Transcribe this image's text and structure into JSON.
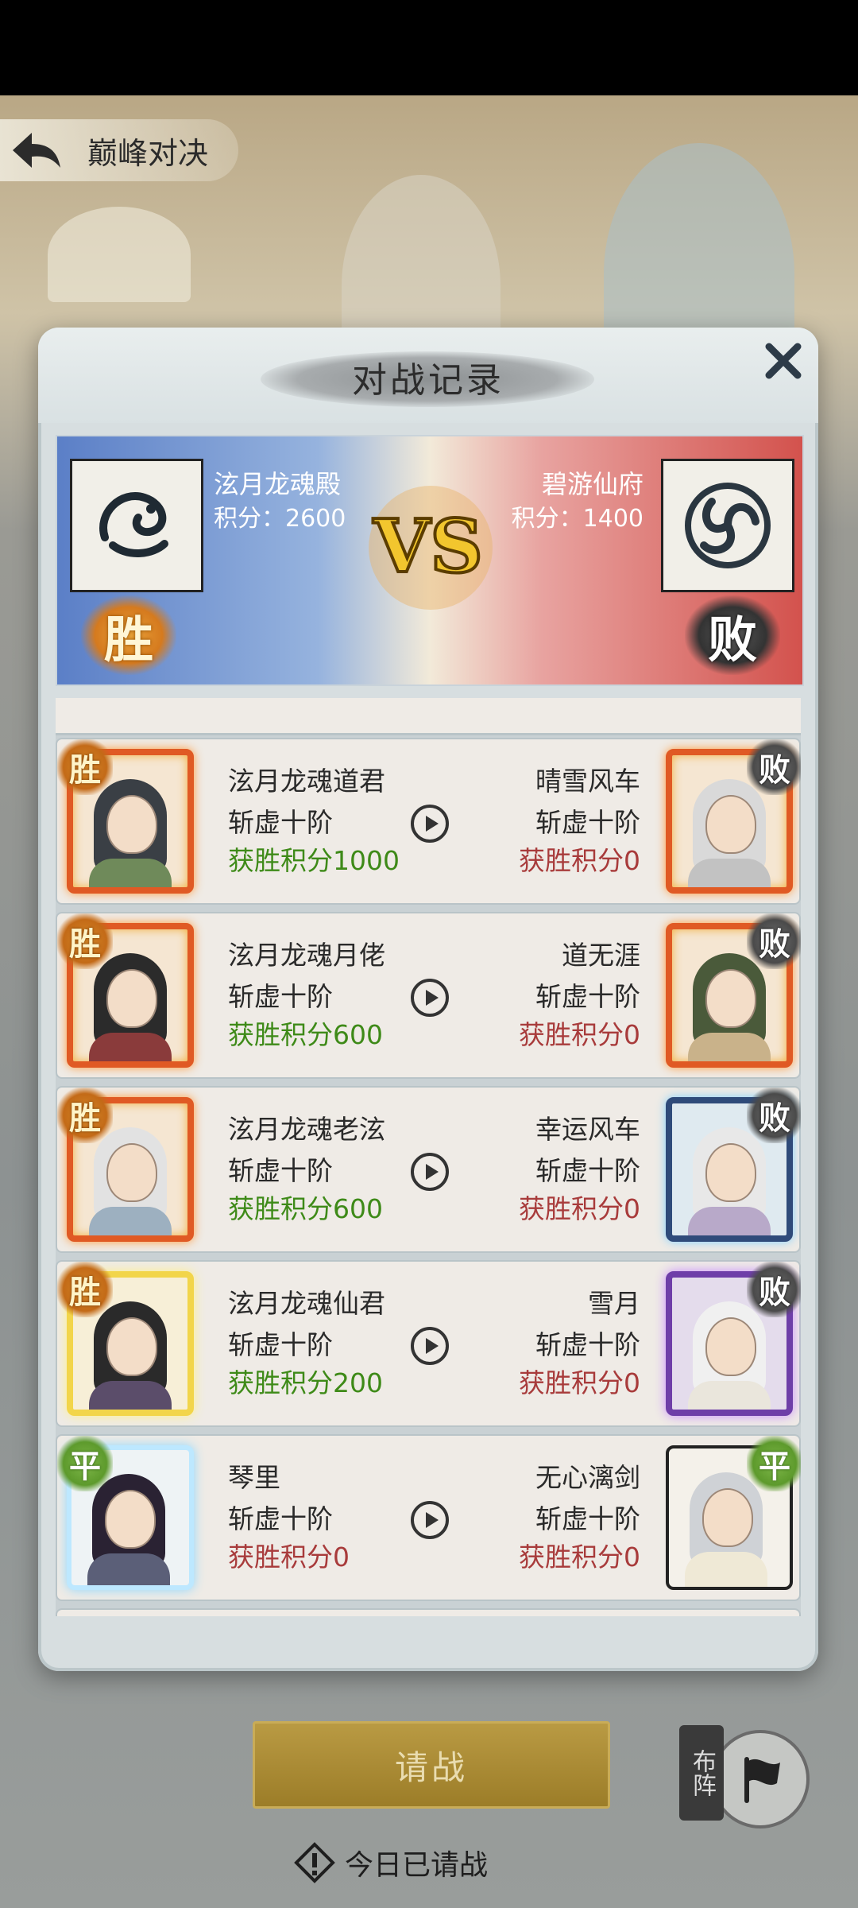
{
  "header": {
    "title": "巅峰对决"
  },
  "modal": {
    "title": "对战记录",
    "banner": {
      "left_team": {
        "name": "泫月龙魂殿",
        "score": "积分：2600",
        "result": "胜"
      },
      "right_team": {
        "name": "碧游仙府",
        "score": "积分：1400",
        "result": "败"
      },
      "vs_text": "VS"
    },
    "records": [
      {
        "left": {
          "name": "泫月龙魂道君",
          "rank": "斩虚十阶",
          "points": "获胜积分1000",
          "result": "胜",
          "frame": "dragon"
        },
        "right": {
          "name": "晴雪风车",
          "rank": "斩虚十阶",
          "points": "获胜积分0",
          "result": "败",
          "frame": "dragon"
        }
      },
      {
        "left": {
          "name": "泫月龙魂月佬",
          "rank": "斩虚十阶",
          "points": "获胜积分600",
          "result": "胜",
          "frame": "dragon"
        },
        "right": {
          "name": "道无涯",
          "rank": "斩虚十阶",
          "points": "获胜积分0",
          "result": "败",
          "frame": "dragon"
        }
      },
      {
        "left": {
          "name": "泫月龙魂老泫",
          "rank": "斩虚十阶",
          "points": "获胜积分600",
          "result": "胜",
          "frame": "dragon"
        },
        "right": {
          "name": "幸运风车",
          "rank": "斩虚十阶",
          "points": "获胜积分0",
          "result": "败",
          "frame": "ice"
        }
      },
      {
        "left": {
          "name": "泫月龙魂仙君",
          "rank": "斩虚十阶",
          "points": "获胜积分200",
          "result": "胜",
          "frame": "gold"
        },
        "right": {
          "name": "雪月",
          "rank": "斩虚十阶",
          "points": "获胜积分0",
          "result": "败",
          "frame": "purple"
        }
      },
      {
        "left": {
          "name": "琴里",
          "rank": "斩虚十阶",
          "points": "获胜积分0",
          "result": "平",
          "frame": "blue"
        },
        "right": {
          "name": "无心漓剑",
          "rank": "斩虚十阶",
          "points": "获胜积分0",
          "result": "平",
          "frame": "plain"
        }
      }
    ]
  },
  "actions": {
    "challenge_label": "请战",
    "formation_label": "布阵",
    "daily_notice": "今日已请战"
  },
  "colors": {
    "win_green": "#3e8a18",
    "lose_red": "#a83b3b",
    "banner_blue": "#5b7fc7",
    "banner_red": "#d3524d",
    "button_gold": "#b99a43"
  }
}
